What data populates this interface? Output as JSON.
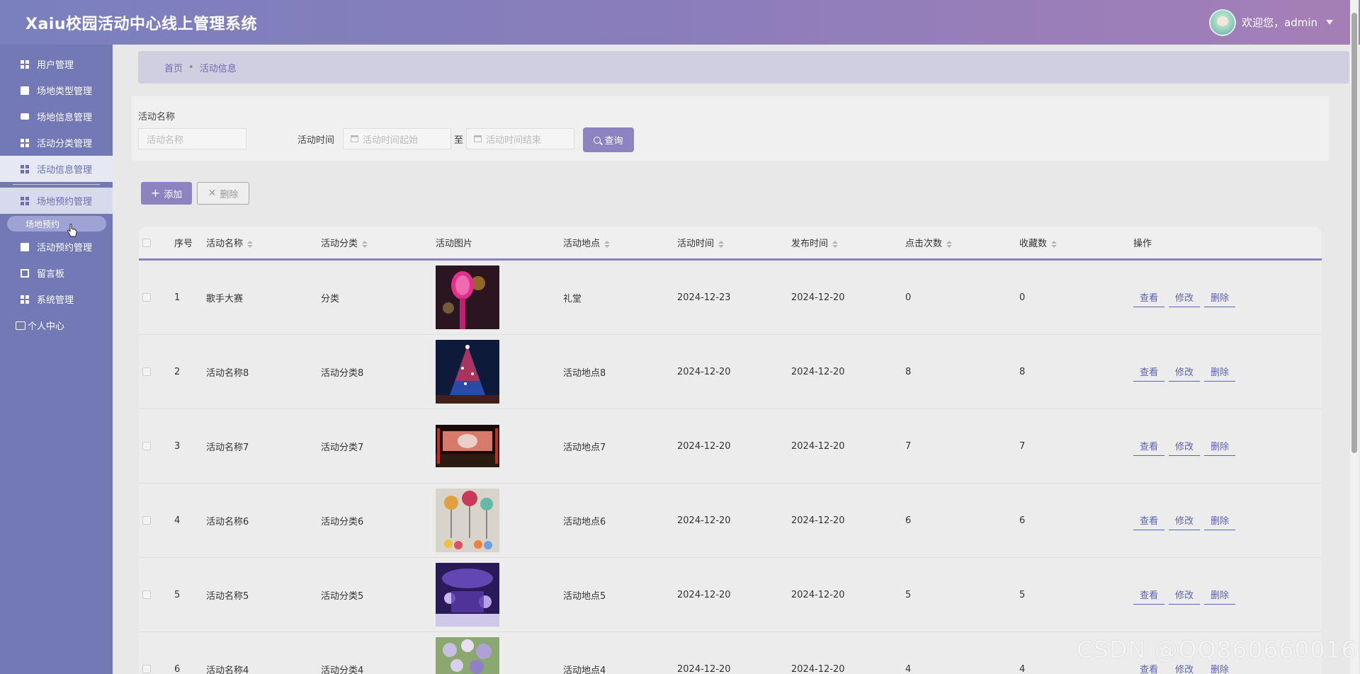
{
  "header": {
    "title": "Xaiu校园活动中心线上管理系统",
    "welcome": "欢迎您，admin"
  },
  "sidebar": {
    "items": [
      {
        "label": "用户管理",
        "icon": "grid-icon"
      },
      {
        "label": "场地类型管理",
        "icon": "clipboard-icon"
      },
      {
        "label": "场地信息管理",
        "icon": "chat-icon"
      },
      {
        "label": "活动分类管理",
        "icon": "grid-icon"
      },
      {
        "label": "活动信息管理",
        "icon": "grid-icon"
      },
      {
        "label": "场地预约管理",
        "icon": "grid-icon"
      },
      {
        "label": "活动预约管理",
        "icon": "clipboard-icon"
      },
      {
        "label": "留言板",
        "icon": "book-icon"
      },
      {
        "label": "系统管理",
        "icon": "grid-icon"
      },
      {
        "label": "个人中心",
        "icon": "card-icon"
      }
    ],
    "sub_item": "场地预约"
  },
  "breadcrumb": {
    "home": "首页",
    "separator": "•",
    "current": "活动信息"
  },
  "search": {
    "name_label": "活动名称",
    "name_placeholder": "活动名称",
    "time_label": "活动时间",
    "start_placeholder": "活动时间起始",
    "to_label": "至",
    "end_placeholder": "活动时间结束",
    "query_label": "查询"
  },
  "actions": {
    "add_label": "添加",
    "delete_label": "删除"
  },
  "table": {
    "headers": {
      "index": "序号",
      "name": "活动名称",
      "category": "活动分类",
      "image": "活动图片",
      "location": "活动地点",
      "time": "活动时间",
      "publish": "发布时间",
      "clicks": "点击次数",
      "favorites": "收藏数",
      "ops": "操作"
    },
    "op_labels": {
      "view": "查看",
      "edit": "修改",
      "delete": "删除"
    },
    "rows": [
      {
        "index": "1",
        "name": "歌手大赛",
        "category": "分类",
        "location": "礼堂",
        "time": "2024-12-23",
        "publish": "2024-12-20",
        "clicks": "0",
        "favorites": "0"
      },
      {
        "index": "2",
        "name": "活动名称8",
        "category": "活动分类8",
        "location": "活动地点8",
        "time": "2024-12-20",
        "publish": "2024-12-20",
        "clicks": "8",
        "favorites": "8"
      },
      {
        "index": "3",
        "name": "活动名称7",
        "category": "活动分类7",
        "location": "活动地点7",
        "time": "2024-12-20",
        "publish": "2024-12-20",
        "clicks": "7",
        "favorites": "7"
      },
      {
        "index": "4",
        "name": "活动名称6",
        "category": "活动分类6",
        "location": "活动地点6",
        "time": "2024-12-20",
        "publish": "2024-12-20",
        "clicks": "6",
        "favorites": "6"
      },
      {
        "index": "5",
        "name": "活动名称5",
        "category": "活动分类5",
        "location": "活动地点5",
        "time": "2024-12-20",
        "publish": "2024-12-20",
        "clicks": "5",
        "favorites": "5"
      },
      {
        "index": "6",
        "name": "活动名称4",
        "category": "活动分类4",
        "location": "活动地点4",
        "time": "2024-12-20",
        "publish": "2024-12-20",
        "clicks": "4",
        "favorites": "4"
      }
    ]
  },
  "watermark": "CSDN @QQ860660016",
  "colors": {
    "accent": "#8d83c0",
    "sidebar": "#7379b4",
    "link": "#5d63b0"
  }
}
